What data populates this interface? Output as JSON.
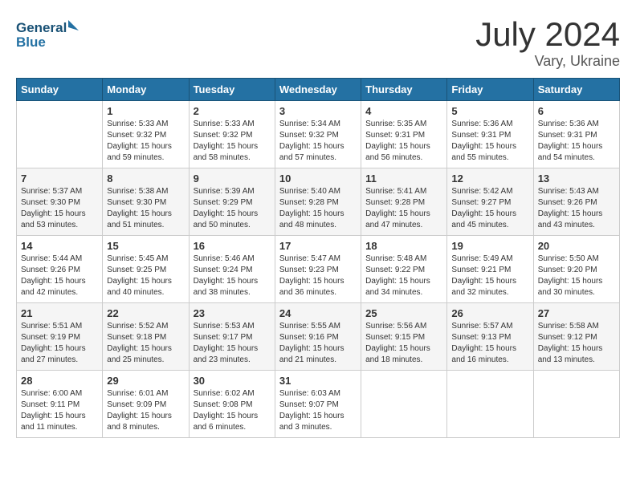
{
  "header": {
    "logo_line1": "General",
    "logo_line2": "Blue",
    "month_year": "July 2024",
    "location": "Vary, Ukraine"
  },
  "days_of_week": [
    "Sunday",
    "Monday",
    "Tuesday",
    "Wednesday",
    "Thursday",
    "Friday",
    "Saturday"
  ],
  "weeks": [
    [
      {
        "day": "",
        "content": ""
      },
      {
        "day": "1",
        "content": "Sunrise: 5:33 AM\nSunset: 9:32 PM\nDaylight: 15 hours\nand 59 minutes."
      },
      {
        "day": "2",
        "content": "Sunrise: 5:33 AM\nSunset: 9:32 PM\nDaylight: 15 hours\nand 58 minutes."
      },
      {
        "day": "3",
        "content": "Sunrise: 5:34 AM\nSunset: 9:32 PM\nDaylight: 15 hours\nand 57 minutes."
      },
      {
        "day": "4",
        "content": "Sunrise: 5:35 AM\nSunset: 9:31 PM\nDaylight: 15 hours\nand 56 minutes."
      },
      {
        "day": "5",
        "content": "Sunrise: 5:36 AM\nSunset: 9:31 PM\nDaylight: 15 hours\nand 55 minutes."
      },
      {
        "day": "6",
        "content": "Sunrise: 5:36 AM\nSunset: 9:31 PM\nDaylight: 15 hours\nand 54 minutes."
      }
    ],
    [
      {
        "day": "7",
        "content": "Sunrise: 5:37 AM\nSunset: 9:30 PM\nDaylight: 15 hours\nand 53 minutes."
      },
      {
        "day": "8",
        "content": "Sunrise: 5:38 AM\nSunset: 9:30 PM\nDaylight: 15 hours\nand 51 minutes."
      },
      {
        "day": "9",
        "content": "Sunrise: 5:39 AM\nSunset: 9:29 PM\nDaylight: 15 hours\nand 50 minutes."
      },
      {
        "day": "10",
        "content": "Sunrise: 5:40 AM\nSunset: 9:28 PM\nDaylight: 15 hours\nand 48 minutes."
      },
      {
        "day": "11",
        "content": "Sunrise: 5:41 AM\nSunset: 9:28 PM\nDaylight: 15 hours\nand 47 minutes."
      },
      {
        "day": "12",
        "content": "Sunrise: 5:42 AM\nSunset: 9:27 PM\nDaylight: 15 hours\nand 45 minutes."
      },
      {
        "day": "13",
        "content": "Sunrise: 5:43 AM\nSunset: 9:26 PM\nDaylight: 15 hours\nand 43 minutes."
      }
    ],
    [
      {
        "day": "14",
        "content": "Sunrise: 5:44 AM\nSunset: 9:26 PM\nDaylight: 15 hours\nand 42 minutes."
      },
      {
        "day": "15",
        "content": "Sunrise: 5:45 AM\nSunset: 9:25 PM\nDaylight: 15 hours\nand 40 minutes."
      },
      {
        "day": "16",
        "content": "Sunrise: 5:46 AM\nSunset: 9:24 PM\nDaylight: 15 hours\nand 38 minutes."
      },
      {
        "day": "17",
        "content": "Sunrise: 5:47 AM\nSunset: 9:23 PM\nDaylight: 15 hours\nand 36 minutes."
      },
      {
        "day": "18",
        "content": "Sunrise: 5:48 AM\nSunset: 9:22 PM\nDaylight: 15 hours\nand 34 minutes."
      },
      {
        "day": "19",
        "content": "Sunrise: 5:49 AM\nSunset: 9:21 PM\nDaylight: 15 hours\nand 32 minutes."
      },
      {
        "day": "20",
        "content": "Sunrise: 5:50 AM\nSunset: 9:20 PM\nDaylight: 15 hours\nand 30 minutes."
      }
    ],
    [
      {
        "day": "21",
        "content": "Sunrise: 5:51 AM\nSunset: 9:19 PM\nDaylight: 15 hours\nand 27 minutes."
      },
      {
        "day": "22",
        "content": "Sunrise: 5:52 AM\nSunset: 9:18 PM\nDaylight: 15 hours\nand 25 minutes."
      },
      {
        "day": "23",
        "content": "Sunrise: 5:53 AM\nSunset: 9:17 PM\nDaylight: 15 hours\nand 23 minutes."
      },
      {
        "day": "24",
        "content": "Sunrise: 5:55 AM\nSunset: 9:16 PM\nDaylight: 15 hours\nand 21 minutes."
      },
      {
        "day": "25",
        "content": "Sunrise: 5:56 AM\nSunset: 9:15 PM\nDaylight: 15 hours\nand 18 minutes."
      },
      {
        "day": "26",
        "content": "Sunrise: 5:57 AM\nSunset: 9:13 PM\nDaylight: 15 hours\nand 16 minutes."
      },
      {
        "day": "27",
        "content": "Sunrise: 5:58 AM\nSunset: 9:12 PM\nDaylight: 15 hours\nand 13 minutes."
      }
    ],
    [
      {
        "day": "28",
        "content": "Sunrise: 6:00 AM\nSunset: 9:11 PM\nDaylight: 15 hours\nand 11 minutes."
      },
      {
        "day": "29",
        "content": "Sunrise: 6:01 AM\nSunset: 9:09 PM\nDaylight: 15 hours\nand 8 minutes."
      },
      {
        "day": "30",
        "content": "Sunrise: 6:02 AM\nSunset: 9:08 PM\nDaylight: 15 hours\nand 6 minutes."
      },
      {
        "day": "31",
        "content": "Sunrise: 6:03 AM\nSunset: 9:07 PM\nDaylight: 15 hours\nand 3 minutes."
      },
      {
        "day": "",
        "content": ""
      },
      {
        "day": "",
        "content": ""
      },
      {
        "day": "",
        "content": ""
      }
    ]
  ]
}
